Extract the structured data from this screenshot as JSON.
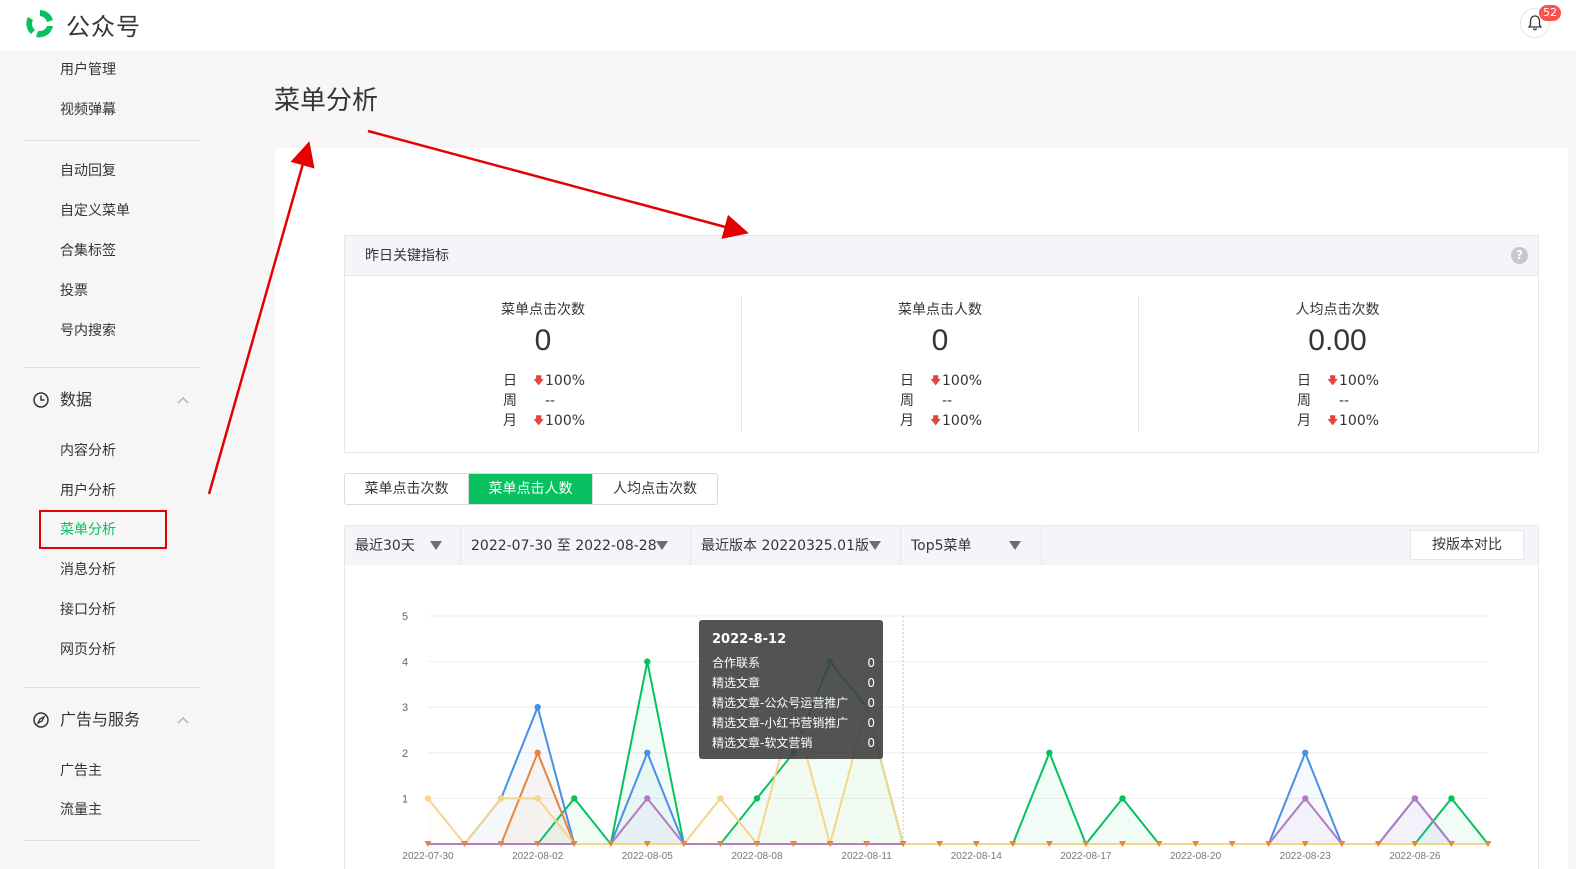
{
  "app": {
    "title": "公众号",
    "notifications": "52"
  },
  "sidebar": {
    "items_top": [
      "用户管理",
      "视频弹幕"
    ],
    "items_mid": [
      "自动回复",
      "自定义菜单",
      "合集标签",
      "投票",
      "号内搜索"
    ],
    "group_data": {
      "label": "数据",
      "icon": "clock-icon"
    },
    "items_data": [
      "内容分析",
      "用户分析",
      "菜单分析",
      "消息分析",
      "接口分析",
      "网页分析"
    ],
    "active_item": "菜单分析",
    "group_ads": {
      "label": "广告与服务",
      "icon": "compass-icon"
    },
    "items_ads": [
      "广告主",
      "流量主"
    ]
  },
  "page": {
    "title": "菜单分析"
  },
  "kpi": {
    "header": "昨日关键指标",
    "help": "?",
    "row_labels": {
      "day": "日",
      "week": "周",
      "month": "月"
    },
    "columns": [
      {
        "label": "菜单点击次数",
        "value": "0",
        "day": "100%",
        "week": "--",
        "month": "100%"
      },
      {
        "label": "菜单点击人数",
        "value": "0",
        "day": "100%",
        "week": "--",
        "month": "100%"
      },
      {
        "label": "人均点击次数",
        "value": "0.00",
        "day": "100%",
        "week": "--",
        "month": "100%"
      }
    ]
  },
  "tabs": [
    "菜单点击次数",
    "菜单点击人数",
    "人均点击次数"
  ],
  "active_tab": "菜单点击人数",
  "filters": {
    "period": "最近30天",
    "date_range": "2022-07-30 至 2022-08-28",
    "version": "最近版本 20220325.01版",
    "top": "Top5菜单",
    "compare": "按版本对比"
  },
  "tooltip": {
    "title": "2022-8-12",
    "rows": [
      {
        "name": "合作联系",
        "value": "0"
      },
      {
        "name": "精选文章",
        "value": "0"
      },
      {
        "name": "精选文章-公众号运营推广",
        "value": "0"
      },
      {
        "name": "精选文章-小红书营销推广",
        "value": "0"
      },
      {
        "name": "精选文章-软文营销",
        "value": "0"
      }
    ]
  },
  "colors": {
    "accent": "#07c160",
    "annotation": "#e60000",
    "down": "#e64340"
  },
  "chart_data": {
    "type": "line",
    "ylim": [
      0,
      5
    ],
    "yticks": [
      1,
      2,
      3,
      4,
      5
    ],
    "xtick_labels": [
      "2022-07-30",
      "2022-08-02",
      "2022-08-05",
      "2022-08-08",
      "2022-08-11",
      "2022-08-14",
      "2022-08-17",
      "2022-08-20",
      "2022-08-23",
      "2022-08-26"
    ],
    "xtick_every": 3,
    "n_points": 30,
    "highlight_index": 13,
    "series": [
      {
        "color": "#07c160",
        "values": [
          0,
          0,
          0,
          0,
          1,
          0,
          4,
          0,
          0,
          1,
          2,
          4,
          3,
          0,
          0,
          0,
          0,
          2,
          0,
          1,
          0,
          0,
          0,
          0,
          0,
          0,
          0,
          0,
          1,
          0
        ]
      },
      {
        "color": "#4a90e2",
        "values": [
          0,
          0,
          1,
          3,
          0,
          0,
          2,
          0,
          0,
          0,
          0,
          0,
          0,
          0,
          0,
          0,
          0,
          0,
          0,
          0,
          0,
          0,
          0,
          0,
          2,
          0,
          0,
          1,
          0,
          0
        ]
      },
      {
        "color": "#e8843c",
        "values": [
          0,
          0,
          0,
          2,
          0,
          0,
          0,
          0,
          0,
          0,
          0,
          0,
          0,
          0,
          0,
          0,
          0,
          0,
          0,
          0,
          0,
          0,
          0,
          0,
          0,
          0,
          0,
          0,
          0,
          0
        ]
      },
      {
        "color": "#b37cc2",
        "values": [
          0,
          0,
          0,
          0,
          0,
          0,
          1,
          0,
          0,
          0,
          0,
          0,
          0,
          0,
          0,
          0,
          0,
          0,
          0,
          0,
          0,
          0,
          0,
          0,
          1,
          0,
          0,
          1,
          0,
          0
        ]
      },
      {
        "color": "#f5d58a",
        "values": [
          1,
          0,
          1,
          1,
          0,
          0,
          0,
          0,
          1,
          0,
          3,
          0,
          3,
          0,
          0,
          0,
          0,
          0,
          0,
          0,
          0,
          0,
          0,
          0,
          0,
          0,
          0,
          0,
          0,
          0
        ]
      }
    ]
  }
}
